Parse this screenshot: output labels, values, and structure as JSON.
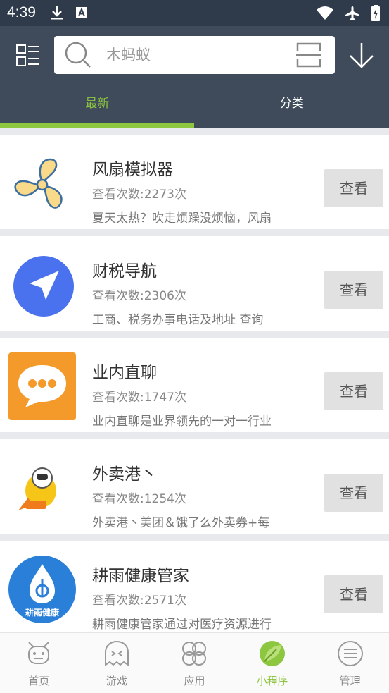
{
  "status_bar": {
    "time": "4:39",
    "icons": [
      "download-icon",
      "font-a-icon",
      "wifi-icon",
      "airplane-icon",
      "battery-charging-icon"
    ]
  },
  "search": {
    "placeholder": "木蚂蚁"
  },
  "tabs": [
    {
      "label": "最新",
      "active": true
    },
    {
      "label": "分类",
      "active": false
    }
  ],
  "colors": {
    "accent": "#8dc63f",
    "header_bg": "#3f4b5b",
    "status_bg": "#2f3b4b"
  },
  "items": [
    {
      "title": "风扇模拟器",
      "views": "查看次数:2273次",
      "desc": "夏天太热？吹走烦躁没烦恼，风扇",
      "button": "查看",
      "icon": "fan-icon"
    },
    {
      "title": "财税导航",
      "views": "查看次数:2306次",
      "desc": "工商、税务办事电话及地址 查询",
      "button": "查看",
      "icon": "navigation-arrow-icon"
    },
    {
      "title": "业内直聊",
      "views": "查看次数:1747次",
      "desc": "业内直聊是业界领先的一对一行业",
      "button": "查看",
      "icon": "chat-bubble-icon"
    },
    {
      "title": "外卖港丶",
      "views": "查看次数:1254次",
      "desc": "外卖港丶美团＆饿了么外卖券+每",
      "button": "查看",
      "icon": "astronaut-rocket-icon"
    },
    {
      "title": "耕雨健康管家",
      "views": "查看次数:2571次",
      "desc": "耕雨健康管家通过对医疗资源进行",
      "button": "查看",
      "icon": "water-drop-icon",
      "icon_text": "耕雨健康"
    }
  ],
  "bottom_nav": [
    {
      "label": "首页",
      "icon": "robot-home-icon",
      "active": false
    },
    {
      "label": "游戏",
      "icon": "ghost-game-icon",
      "active": false
    },
    {
      "label": "应用",
      "icon": "clover-apps-icon",
      "active": false
    },
    {
      "label": "小程序",
      "icon": "leaf-miniapp-icon",
      "active": true
    },
    {
      "label": "管理",
      "icon": "menu-circle-icon",
      "active": false
    }
  ]
}
